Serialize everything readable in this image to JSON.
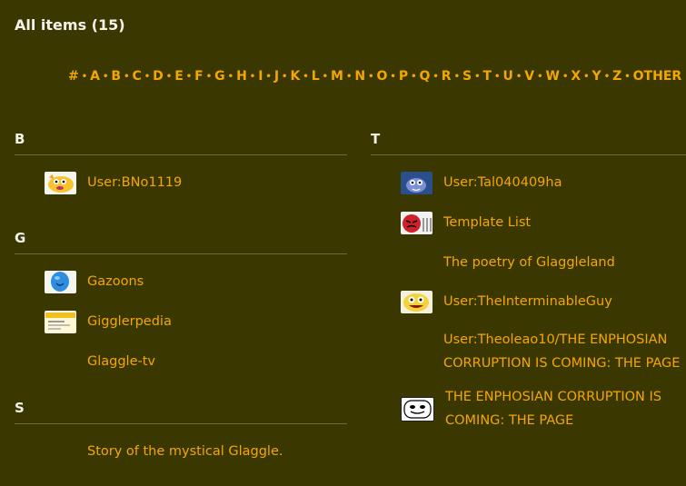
{
  "page": {
    "title": "All items (15)"
  },
  "alpha_nav": [
    "#",
    "A",
    "B",
    "C",
    "D",
    "E",
    "F",
    "G",
    "H",
    "I",
    "J",
    "K",
    "L",
    "M",
    "N",
    "O",
    "P",
    "Q",
    "R",
    "S",
    "T",
    "U",
    "V",
    "W",
    "X",
    "Y",
    "Z",
    "OTHER"
  ],
  "groups": {
    "b": {
      "letter": "B",
      "items": [
        {
          "label": "User:BNo1119",
          "icon": "yellow-cat-thumb"
        }
      ]
    },
    "g": {
      "letter": "G",
      "items": [
        {
          "label": "Gazoons",
          "icon": "blue-balloon-thumb"
        },
        {
          "label": "Gigglerpedia",
          "icon": "yellow-sign-thumb"
        },
        {
          "label": "Glaggle-tv",
          "icon": ""
        }
      ]
    },
    "s": {
      "letter": "S",
      "items": [
        {
          "label": "Story of the mystical Glaggle.",
          "icon": ""
        }
      ]
    },
    "t": {
      "letter": "T",
      "items": [
        {
          "label": "User:Tal040409ha",
          "icon": "blue-character-thumb"
        },
        {
          "label": "Template List",
          "icon": "red-face-thumb"
        },
        {
          "label": "The poetry of Glaggleland",
          "icon": ""
        },
        {
          "label": "User:TheInterminableGuy",
          "icon": "yellow-grin-thumb"
        },
        {
          "label": "User:Theoleao10/THE ENPHOSIAN CORRUPTION IS COMING: THE PAGE",
          "icon": ""
        },
        {
          "label": "THE ENPHOSIAN CORRUPTION IS COMING: THE PAGE",
          "icon": "white-face-thumb"
        }
      ]
    }
  },
  "colors": {
    "background": "#3a3800",
    "link": "#f5a600",
    "heading": "#f2f2ea",
    "divider": "#6d6b3a"
  }
}
